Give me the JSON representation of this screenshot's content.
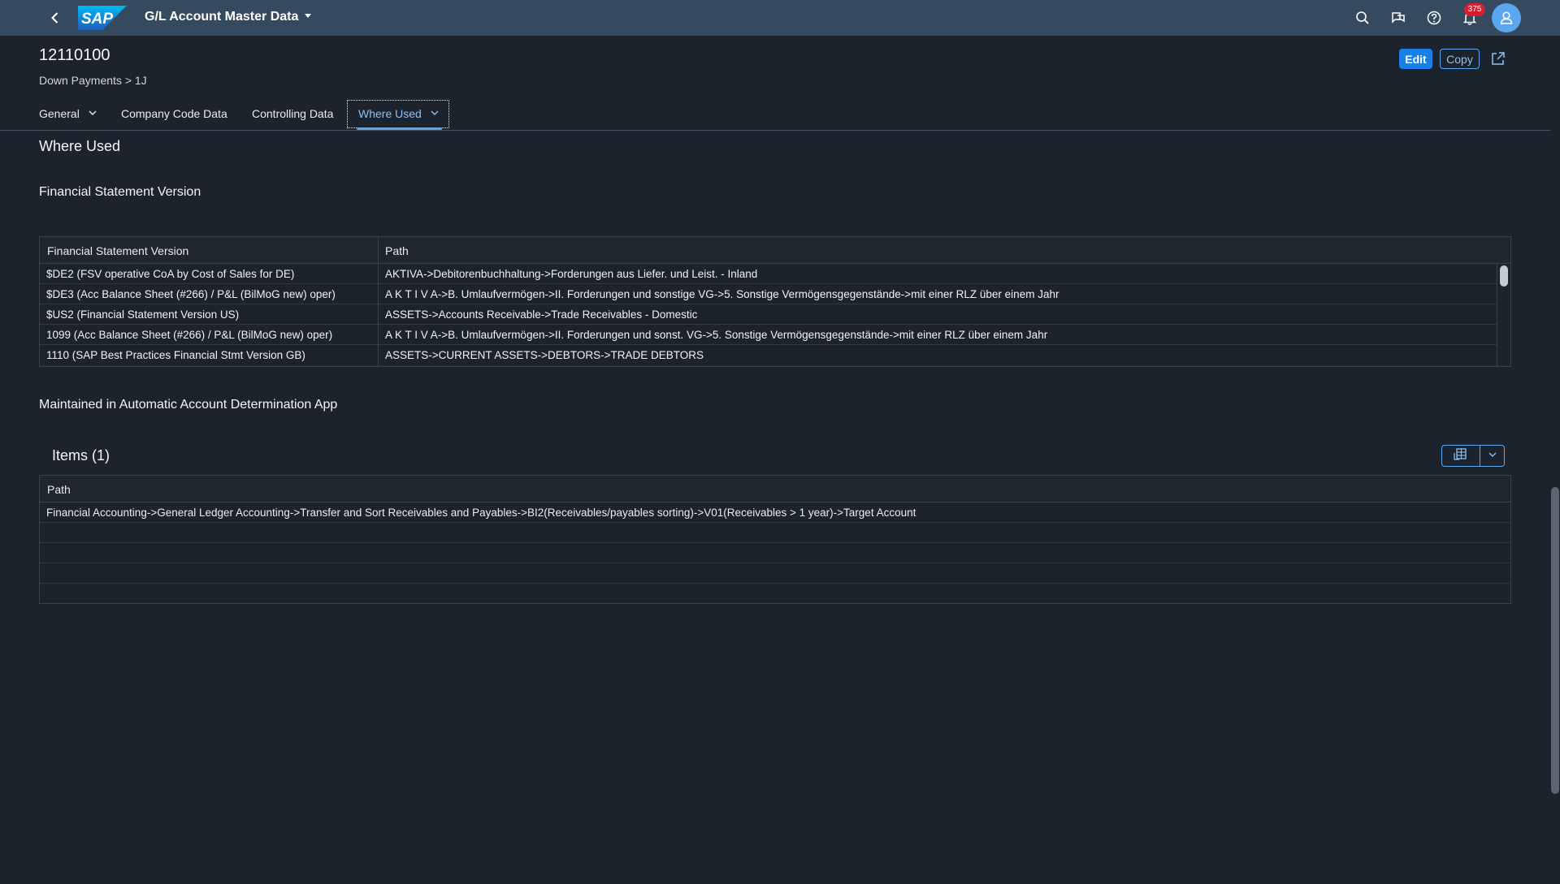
{
  "shell": {
    "app_title": "G/L Account Master Data",
    "notification_count": "375"
  },
  "header": {
    "title": "12110100",
    "subtitle": "Down Payments > 1J",
    "edit_label": "Edit",
    "copy_label": "Copy"
  },
  "tabs": [
    {
      "label": "General"
    },
    {
      "label": "Company Code Data"
    },
    {
      "label": "Controlling Data"
    },
    {
      "label": "Where Used"
    }
  ],
  "section": {
    "title": "Where Used",
    "fsv_title": "Financial Statement Version",
    "aad_title": "Maintained in Automatic Account Determination App"
  },
  "fsv_table": {
    "columns": [
      "Financial Statement Version",
      "Path"
    ],
    "rows": [
      {
        "version": "$DE2 (FSV operative CoA by Cost of Sales for DE)",
        "path": "AKTIVA->Debitorenbuchhaltung->Forderungen aus Liefer. und Leist. - Inland"
      },
      {
        "version": "$DE3 (Acc Balance Sheet (#266) / P&L (BilMoG new) oper)",
        "path": "A K T I V A->B. Umlaufvermögen->II. Forderungen und sonstige VG->5. Sonstige Vermögensgegenstände->mit einer RLZ über einem Jahr"
      },
      {
        "version": "$US2 (Financial Statement Version US)",
        "path": "ASSETS->Accounts Receivable->Trade Receivables - Domestic"
      },
      {
        "version": "1099 (Acc Balance Sheet (#266) / P&L (BilMoG new) oper)",
        "path": "A K T I V A->B. Umlaufvermögen->II. Forderungen und sonst. VG->5. Sonstige Vermögensgegenstände->mit einer RLZ über einem Jahr"
      },
      {
        "version": "1110 (SAP Best Practices Financial Stmt Version GB)",
        "path": "ASSETS->CURRENT ASSETS->DEBTORS->TRADE DEBTORS"
      }
    ]
  },
  "items_table": {
    "title": "Items (1)",
    "column": "Path",
    "rows": [
      {
        "path": "Financial Accounting->General Ledger Accounting->Transfer and Sort Receivables and Payables->BI2(Receivables/payables sorting)->V01(Receivables > 1 year)->Target Account"
      }
    ]
  },
  "icons": {
    "back": "back-icon",
    "search": "search-icon",
    "feedback": "feedback-icon",
    "help": "help-icon",
    "notifications": "bell-icon",
    "avatar": "user-icon",
    "share": "share-icon",
    "export": "spreadsheet-export-icon"
  },
  "colors": {
    "shell_bar": "#354a5f",
    "background": "#1d232c",
    "accent": "#5aa7f0",
    "emphasized_button": "#1b80e6",
    "badge": "#d32030"
  }
}
